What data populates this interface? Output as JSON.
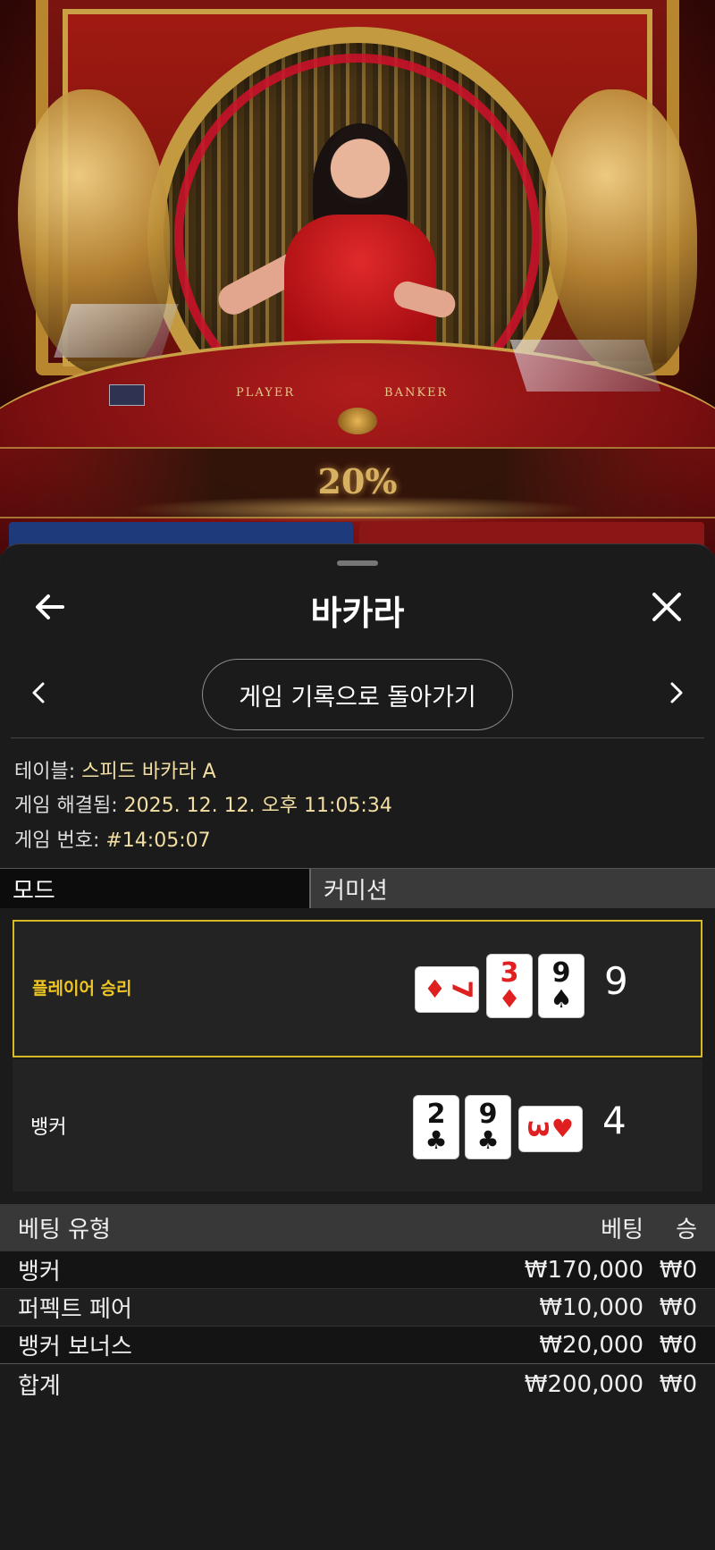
{
  "video": {
    "table_labels": {
      "player": "PLAYER",
      "banker": "BANKER"
    },
    "multiplier": "20%"
  },
  "sheet": {
    "title": "바카라",
    "back_icon": "arrow-left-icon",
    "close_icon": "close-icon",
    "nav_pill_label": "게임 기록으로 돌아가기",
    "info": {
      "table_label": "테이블: ",
      "table_value": "스피드 바카라 A",
      "resolved_label": "게임 해결됨: ",
      "resolved_value": "2025. 12. 12. 오후 11:05:34",
      "game_no_label": "게임 번호: ",
      "game_no_value": "#14:05:07"
    },
    "modes": {
      "mode_label": "모드",
      "commission_label": "커미션"
    },
    "results": {
      "player": {
        "label": "플레이어 승리",
        "score": "9",
        "cards": [
          {
            "rank": "7",
            "suit": "♦",
            "color": "red",
            "orientation": "horizontal"
          },
          {
            "rank": "3",
            "suit": "♦",
            "color": "red",
            "orientation": "vertical"
          },
          {
            "rank": "9",
            "suit": "♠",
            "color": "black",
            "orientation": "vertical"
          }
        ]
      },
      "banker": {
        "label": "뱅커",
        "score": "4",
        "cards": [
          {
            "rank": "2",
            "suit": "♣",
            "color": "black",
            "orientation": "vertical"
          },
          {
            "rank": "9",
            "suit": "♣",
            "color": "black",
            "orientation": "vertical"
          },
          {
            "rank": "3",
            "suit": "♥",
            "color": "red",
            "orientation": "horizontal"
          }
        ]
      },
      "accent_color": "#d9b826"
    },
    "bets": {
      "headers": {
        "type": "베팅 유형",
        "bet": "베팅",
        "win": "승"
      },
      "rows": [
        {
          "type": "뱅커",
          "bet": "₩170,000",
          "win": "₩0"
        },
        {
          "type": "퍼펙트 페어",
          "bet": "₩10,000",
          "win": "₩0"
        },
        {
          "type": "뱅커 보너스",
          "bet": "₩20,000",
          "win": "₩0"
        }
      ],
      "total": {
        "type": "합계",
        "bet": "₩200,000",
        "win": "₩0"
      }
    }
  }
}
